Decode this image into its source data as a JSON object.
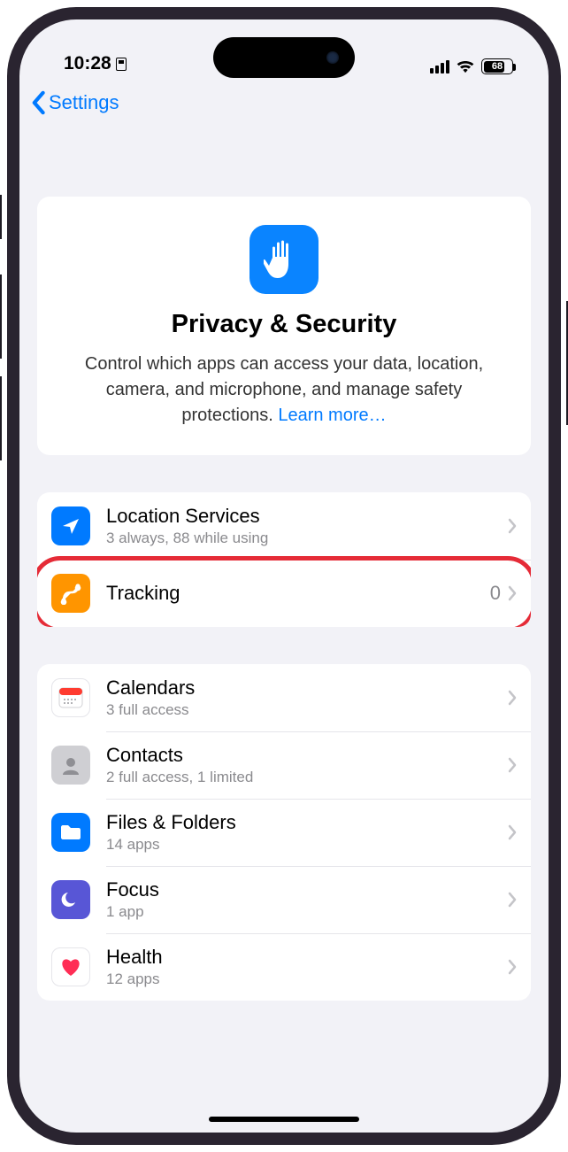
{
  "status": {
    "time": "10:28",
    "battery_percent": "68"
  },
  "nav": {
    "back_label": "Settings"
  },
  "hero": {
    "title": "Privacy & Security",
    "subtitle_1": "Control which apps can access your data, location, camera, and microphone, and manage safety protections. ",
    "learn_more": "Learn more…"
  },
  "group1": {
    "location": {
      "title": "Location Services",
      "sub": "3 always, 88 while using"
    },
    "tracking": {
      "title": "Tracking",
      "count": "0"
    }
  },
  "group2": {
    "calendars": {
      "title": "Calendars",
      "sub": "3 full access"
    },
    "contacts": {
      "title": "Contacts",
      "sub": "2 full access, 1 limited"
    },
    "files": {
      "title": "Files & Folders",
      "sub": "14 apps"
    },
    "focus": {
      "title": "Focus",
      "sub": "1 app"
    },
    "health": {
      "title": "Health",
      "sub": "12 apps"
    }
  }
}
